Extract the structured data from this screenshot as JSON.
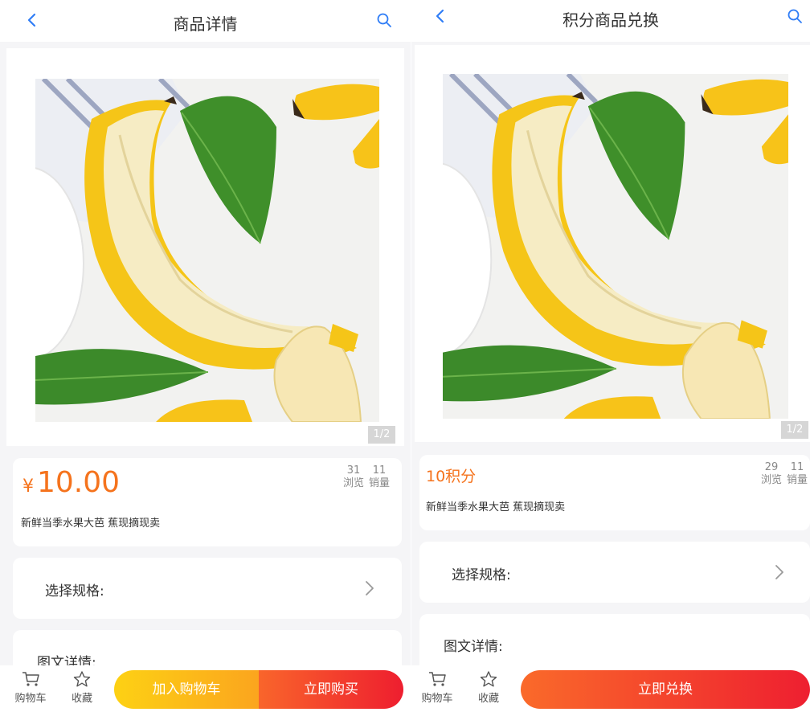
{
  "colors": {
    "accent_blue": "#2f7df6",
    "price_orange": "#f5731d",
    "cart_gradient": [
      "#fdd114",
      "#fba51e"
    ],
    "buy_gradient": [
      "#f9652b",
      "#ee1e2f"
    ]
  },
  "left": {
    "header": {
      "title": "商品详情",
      "back_icon": "chevron-left-icon",
      "search_icon": "search-icon"
    },
    "gallery": {
      "pager": "1/2"
    },
    "price": {
      "symbol": "¥",
      "value": "10.00"
    },
    "stats": {
      "views": "31",
      "views_label": "浏览",
      "sales": "11",
      "sales_label": "销量"
    },
    "description": "新鲜当季水果大芭 蕉现摘现卖",
    "spec": {
      "label": "选择规格:"
    },
    "detail": {
      "label": "图文详情:"
    },
    "bottom": {
      "cart_label": "购物车",
      "favorite_label": "收藏",
      "add_to_cart": "加入购物车",
      "buy_now": "立即购买"
    }
  },
  "right": {
    "header": {
      "title": "积分商品兑换",
      "back_icon": "chevron-left-icon",
      "search_icon": "search-icon"
    },
    "gallery": {
      "pager": "1/2"
    },
    "price": {
      "value": "10积分"
    },
    "stats": {
      "views": "29",
      "views_label": "浏览",
      "sales": "11",
      "sales_label": "销量"
    },
    "description": "新鲜当季水果大芭 蕉现摘现卖",
    "spec": {
      "label": "选择规格:"
    },
    "detail": {
      "label": "图文详情:"
    },
    "bottom": {
      "cart_label": "购物车",
      "favorite_label": "收藏",
      "redeem_now": "立即兑换"
    }
  }
}
